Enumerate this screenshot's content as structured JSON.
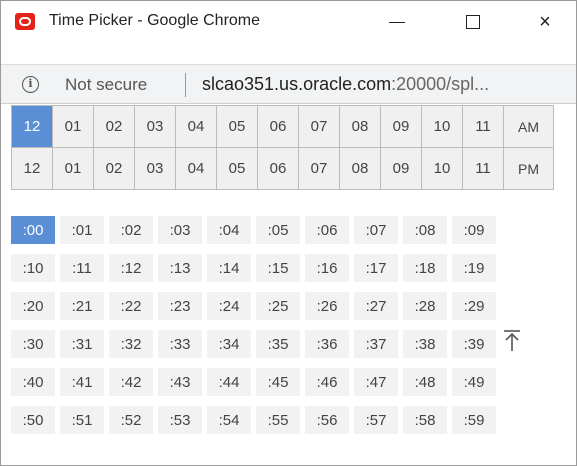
{
  "window": {
    "title": "Time Picker - Google Chrome",
    "close_glyph": "×"
  },
  "address": {
    "info_icon": "i",
    "security_label": "Not secure",
    "url_host": "slcao351.us.oracle.com",
    "url_rest": ":20000/spl..."
  },
  "hours": {
    "row_am": [
      "12",
      "01",
      "02",
      "03",
      "04",
      "05",
      "06",
      "07",
      "08",
      "09",
      "10",
      "11"
    ],
    "am_label": "AM",
    "row_pm": [
      "12",
      "01",
      "02",
      "03",
      "04",
      "05",
      "06",
      "07",
      "08",
      "09",
      "10",
      "11"
    ],
    "pm_label": "PM",
    "selected": "12 AM"
  },
  "minutes": {
    "rows": [
      [
        ":00",
        ":01",
        ":02",
        ":03",
        ":04",
        ":05",
        ":06",
        ":07",
        ":08",
        ":09"
      ],
      [
        ":10",
        ":11",
        ":12",
        ":13",
        ":14",
        ":15",
        ":16",
        ":17",
        ":18",
        ":19"
      ],
      [
        ":20",
        ":21",
        ":22",
        ":23",
        ":24",
        ":25",
        ":26",
        ":27",
        ":28",
        ":29"
      ],
      [
        ":30",
        ":31",
        ":32",
        ":33",
        ":34",
        ":35",
        ":36",
        ":37",
        ":38",
        ":39"
      ],
      [
        ":40",
        ":41",
        ":42",
        ":43",
        ":44",
        ":45",
        ":46",
        ":47",
        ":48",
        ":49"
      ],
      [
        ":50",
        ":51",
        ":52",
        ":53",
        ":54",
        ":55",
        ":56",
        ":57",
        ":58",
        ":59"
      ]
    ],
    "selected": ":00"
  },
  "colors": {
    "selected": "#5a8fd6",
    "logo": "#e3241b"
  },
  "icons": {
    "scroll_top": "arrow-up-to-line-icon"
  }
}
